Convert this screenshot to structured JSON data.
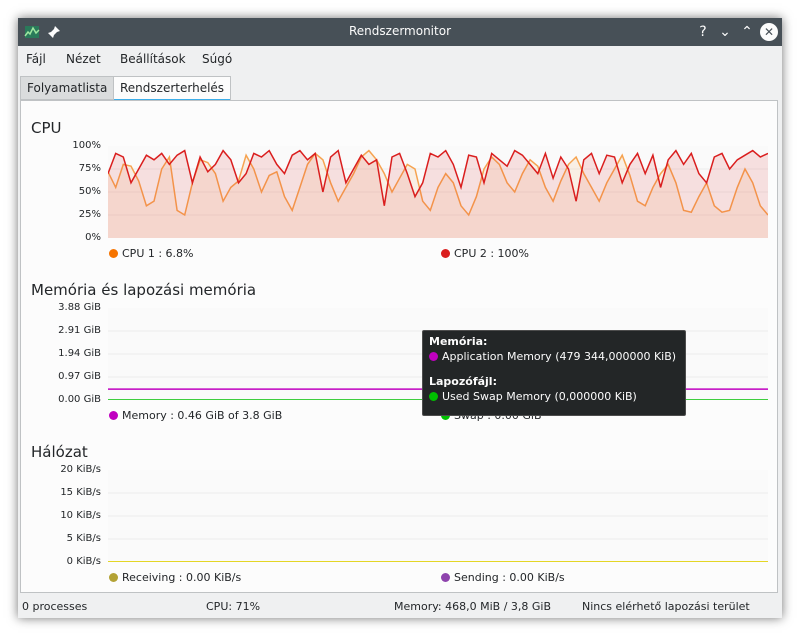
{
  "window": {
    "title": "Rendszermonitor",
    "help_label": "?",
    "minimize_label": "⌄",
    "maximize_label": "⌃",
    "close_label": "✕"
  },
  "menu": [
    "Fájl",
    "Nézet",
    "Beállítások",
    "Súgó"
  ],
  "tabs": {
    "processes": "Folyamatlista",
    "load": "Rendszerterhelés"
  },
  "cpu": {
    "title": "CPU",
    "y_ticks": [
      "100%",
      "75%",
      "50%",
      "25%",
      "0%"
    ],
    "legend": [
      {
        "label": "CPU 1 : 6.8%",
        "color": "#f67400"
      },
      {
        "label": "CPU 2 : 100%",
        "color": "#da1e1e"
      }
    ]
  },
  "memory": {
    "title": "Memória és lapozási memória",
    "y_ticks": [
      "3.88 GiB",
      "2.91 GiB",
      "1.94 GiB",
      "0.97 GiB",
      "0.00 GiB"
    ],
    "legend": [
      {
        "label": "Memory : 0.46 GiB of 3.8 GiB",
        "color": "#c000c0"
      },
      {
        "label": "Swap : 0.00 GiB",
        "color": "#00c000"
      }
    ]
  },
  "network": {
    "title": "Hálózat",
    "y_ticks": [
      "20 KiB/s",
      "15 KiB/s",
      "10 KiB/s",
      "5 KiB/s",
      "0 KiB/s"
    ],
    "legend": [
      {
        "label": "Receiving : 0.00 KiB/s",
        "color": "#b3a235"
      },
      {
        "label": "Sending : 0.00 KiB/s",
        "color": "#8e44ad"
      }
    ]
  },
  "tooltip": {
    "memory_head": "Memória:",
    "memory_item": "Application Memory (479 344,000000 KiB)",
    "memory_color": "#c000c0",
    "swap_head": "Lapozófájl:",
    "swap_item": "Used Swap Memory (0,000000 KiB)",
    "swap_color": "#00c000"
  },
  "status": {
    "processes": "0 processes",
    "cpu": "CPU: 71%",
    "memory": "Memory: 468,0 MiB / 3,8 GiB",
    "swap": "Nincs elérhető lapozási terület"
  },
  "chart_data": [
    {
      "type": "line",
      "title": "CPU",
      "ylim": [
        0,
        100
      ],
      "series": [
        {
          "name": "CPU 1",
          "color": "#f6a350",
          "values": [
            72,
            55,
            80,
            78,
            62,
            35,
            40,
            75,
            88,
            30,
            25,
            60,
            85,
            82,
            70,
            40,
            55,
            62,
            90,
            75,
            50,
            68,
            72,
            45,
            30,
            55,
            80,
            92,
            85,
            60,
            40,
            55,
            70,
            88,
            95,
            85,
            70,
            50,
            65,
            80,
            75,
            40,
            30,
            55,
            70,
            60,
            35,
            25,
            45,
            75,
            88,
            80,
            60,
            50,
            70,
            85,
            78,
            55,
            40,
            62,
            80,
            88,
            70,
            55,
            40,
            60,
            75,
            90,
            68,
            40,
            35,
            55,
            70,
            80,
            60,
            30,
            28,
            45,
            60,
            35,
            28,
            30,
            55,
            75,
            60,
            35,
            25
          ]
        },
        {
          "name": "CPU 2",
          "color": "#da1e1e",
          "values": [
            70,
            92,
            88,
            60,
            75,
            90,
            85,
            92,
            80,
            90,
            95,
            60,
            88,
            72,
            80,
            95,
            85,
            60,
            70,
            92,
            88,
            95,
            80,
            70,
            90,
            95,
            85,
            92,
            50,
            88,
            95,
            60,
            75,
            90,
            80,
            85,
            35,
            88,
            92,
            70,
            45,
            60,
            92,
            88,
            95,
            80,
            55,
            90,
            88,
            60,
            92,
            85,
            78,
            95,
            90,
            80,
            70,
            92,
            65,
            88,
            75,
            40,
            85,
            92,
            70,
            90,
            88,
            60,
            80,
            92,
            70,
            90,
            55,
            85,
            95,
            80,
            92,
            70,
            60,
            88,
            92,
            75,
            85,
            90,
            95,
            88,
            92
          ]
        }
      ]
    },
    {
      "type": "line",
      "title": "Memória és lapozási memória",
      "ylim": [
        0,
        3.88
      ],
      "series": [
        {
          "name": "Memory",
          "color": "#c000c0",
          "values": [
            0.46,
            0.46
          ]
        },
        {
          "name": "Swap",
          "color": "#00c000",
          "values": [
            0.0,
            0.0
          ]
        }
      ]
    },
    {
      "type": "line",
      "title": "Hálózat",
      "ylim": [
        0,
        20
      ],
      "series": [
        {
          "name": "Receiving",
          "color": "#b3a235",
          "values": [
            0,
            0
          ]
        },
        {
          "name": "Sending",
          "color": "#e8d800",
          "values": [
            0,
            0
          ]
        }
      ]
    }
  ]
}
